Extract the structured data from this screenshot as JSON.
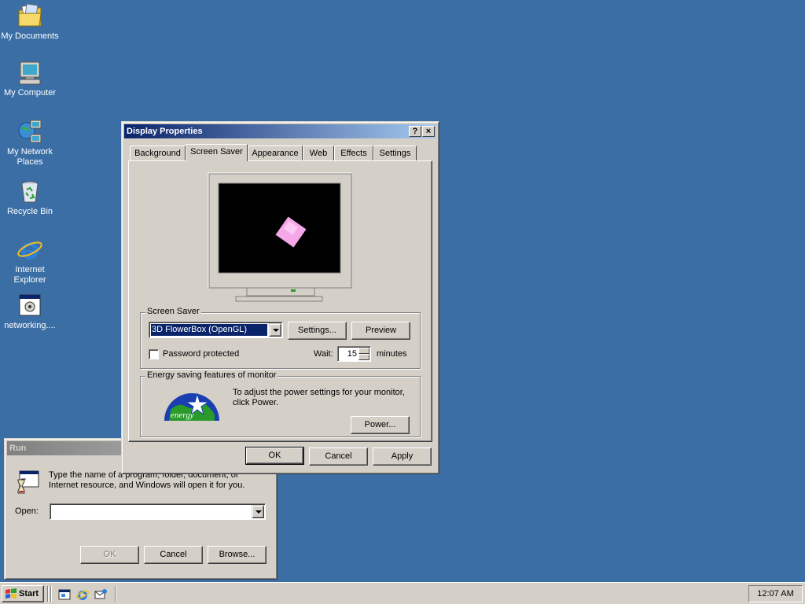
{
  "desktop": {
    "icons": [
      {
        "name": "my-documents-icon",
        "label": "My Documents"
      },
      {
        "name": "my-computer-icon",
        "label": "My Computer"
      },
      {
        "name": "my-network-places-icon",
        "label_line1": "My Network",
        "label_line2": "Places"
      },
      {
        "name": "recycle-bin-icon",
        "label": "Recycle Bin"
      },
      {
        "name": "internet-explorer-icon",
        "label_line1": "Internet",
        "label_line2": "Explorer"
      },
      {
        "name": "networking-shortcut-icon",
        "label": "networking...."
      }
    ],
    "background_color": "#3a6ea5"
  },
  "display_properties": {
    "title": "Display Properties",
    "help_btn": "?",
    "close_btn": "×",
    "tabs": [
      "Background",
      "Screen Saver",
      "Appearance",
      "Web",
      "Effects",
      "Settings"
    ],
    "selected_tab": "Screen Saver",
    "screen_saver_group": "Screen Saver",
    "screen_saver_selected": "3D FlowerBox (OpenGL)",
    "settings_btn": "Settings...",
    "preview_btn": "Preview",
    "password_protected": "Password protected",
    "password_checked": false,
    "wait_label": "Wait:",
    "wait_value": "15",
    "minutes_label": "minutes",
    "energy_group": "Energy saving features of monitor",
    "energy_text": "To adjust the power settings for your monitor, click Power.",
    "energy_logo_text": "energy",
    "power_btn": "Power...",
    "ok_btn": "OK",
    "cancel_btn": "Cancel",
    "apply_btn": "Apply"
  },
  "run_dialog": {
    "title": "Run",
    "description_line1": "Type the name of a program, folder, document, or",
    "description_line2": "Internet resource, and Windows will open it for you.",
    "open_label": "Open:",
    "open_value": "",
    "ok_btn": "OK",
    "cancel_btn": "Cancel",
    "browse_btn": "Browse..."
  },
  "taskbar": {
    "start_label": "Start",
    "quick_launch": [
      "show-desktop-icon",
      "internet-explorer-icon",
      "outlook-express-icon"
    ],
    "clock": "12:07 AM"
  }
}
